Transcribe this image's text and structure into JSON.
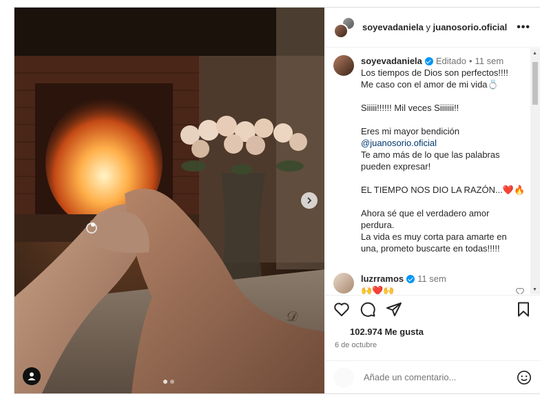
{
  "header": {
    "user1": "soyevadaniela",
    "connector": "y",
    "user2": "juanosorio.oficial",
    "more_icon": "more-horizontal-icon"
  },
  "caption": {
    "username": "soyevadaniela",
    "edited": "Editado",
    "dot": "•",
    "age": "11 sem",
    "lines": [
      "Los tiempos de Dios son perfectos!!!!",
      "Me caso con el amor de mi vida💍",
      "",
      "Siiiii!!!!!! Mil veces Siiiiiii!!",
      "",
      "Eres mi mayor bendición",
      "@juanosorio.oficial",
      "Te amo más de lo que las palabras",
      "pueden expresar!",
      "",
      "EL TIEMPO NOS DIO LA RAZÓN...❤️🔥",
      "",
      "Ahora sé que el verdadero amor",
      "perdura.",
      "La vida es muy corta para amarte en",
      "una, prometo buscarte en todas!!!!!"
    ]
  },
  "comment": {
    "username": "luzrramos",
    "age": "11 sem",
    "text": "🙌❤️🙌"
  },
  "actions": {
    "likes": "102.974 Me gusta",
    "date": "6 de octubre"
  },
  "add_comment": {
    "placeholder": "Añade un comentario..."
  },
  "colors": {
    "verified": "#0095f6",
    "link": "#00376b",
    "muted": "#737373"
  }
}
